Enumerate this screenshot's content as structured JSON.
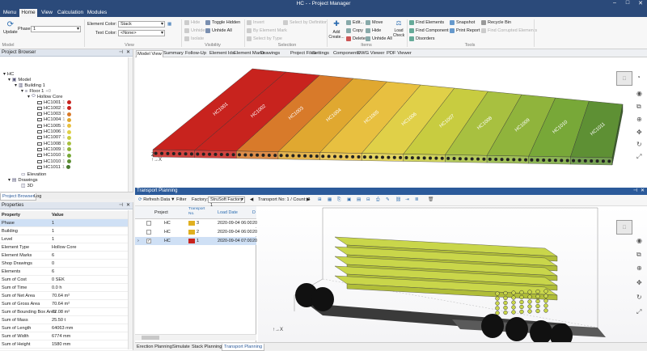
{
  "window": {
    "title": "HC - - Project Manager",
    "minimize": "–",
    "maximize": "□",
    "close": "✕"
  },
  "tabs": [
    "Menu",
    "Home",
    "View",
    "Calculation",
    "Modules"
  ],
  "ribbon": {
    "update": "Update",
    "phase_label": "Phase:",
    "phase_value": "1",
    "element_color_label": "Element Color:",
    "element_color_value": "Stack",
    "text_color_label": "Text Color:",
    "text_color_value": "<None>",
    "visibility": [
      "Hide",
      "Unhide",
      "Isolate",
      "Toggle Hidden",
      "Unhide All"
    ],
    "selection": [
      "Invert",
      "By Element Mark",
      "Select by Type",
      "Select by Definition"
    ],
    "create": "Add Create...",
    "items": [
      "Edit...",
      "Copy",
      "Delete",
      "Move",
      "Hide",
      "Unhide All",
      "Hide Ids"
    ],
    "load_check": "Load Check",
    "tools": [
      "Find Elements",
      "Find Component",
      "Disorders",
      "Snapshot",
      "Print Report",
      "Recycle Bin",
      "Find Corrupted Elements"
    ],
    "groups": [
      "Model",
      "View",
      "Visibility",
      "Selection",
      "Items",
      "Tools"
    ]
  },
  "project_browser": {
    "title": "Project Browser",
    "root": "HC",
    "model": "Model",
    "building": "Building 1",
    "floor": "Floor 1",
    "floor_badge": "+0",
    "group": "Hollow Core",
    "elements": [
      {
        "name": "HC1001",
        "count": "1",
        "color": "#c8231e"
      },
      {
        "name": "HC1002",
        "count": "1",
        "color": "#c8231e"
      },
      {
        "name": "HC1003",
        "count": "1",
        "color": "#d87a2a"
      },
      {
        "name": "HC1004",
        "count": "1",
        "color": "#e0a830"
      },
      {
        "name": "HC1005",
        "count": "1",
        "color": "#e8c040"
      },
      {
        "name": "HC1006",
        "count": "1",
        "color": "#e0d048"
      },
      {
        "name": "HC1007",
        "count": "1",
        "color": "#c8cc40"
      },
      {
        "name": "HC1008",
        "count": "1",
        "color": "#a8c040"
      },
      {
        "name": "HC1009",
        "count": "1",
        "color": "#90b43c"
      },
      {
        "name": "HC1010",
        "count": "1",
        "color": "#78a838"
      },
      {
        "name": "HC1010",
        "count": "1",
        "color": "#5e9034"
      },
      {
        "name": "HC1011",
        "count": "1",
        "color": "#4a7a30"
      }
    ],
    "elevation": "Elevation",
    "drawings": "Drawings",
    "threed": "3D",
    "tabs": [
      "Project Browser",
      "Log"
    ]
  },
  "properties": {
    "title": "Properties",
    "col_property": "Property",
    "col_value": "Value",
    "rows": [
      [
        "Phase",
        "1"
      ],
      [
        "Building",
        "1"
      ],
      [
        "Level",
        "1"
      ],
      [
        "Element Type",
        "Hollow Core"
      ],
      [
        "Element Marks",
        "6"
      ],
      [
        "Shop Drawings",
        "0"
      ],
      [
        "Elements",
        "6"
      ],
      [
        "Sum of Cost",
        "0 SEK"
      ],
      [
        "Sum of Time",
        "0.0 h"
      ],
      [
        "Sum of Net Area",
        "70.64 m²"
      ],
      [
        "Sum of Gross Area",
        "70.64 m²"
      ],
      [
        "Sum of Bounding Box Area",
        "72.08 m²"
      ],
      [
        "Sum of Mass",
        "25.50 t"
      ],
      [
        "Sum of Length",
        "64063 mm"
      ],
      [
        "Sum of Width",
        "6774 mm"
      ],
      [
        "Sum of Height",
        "1580 mm"
      ]
    ]
  },
  "view_tabs": [
    "Model View",
    "Summary",
    "Follow-Up",
    "Element Ids",
    "Element Marks",
    "Drawings",
    "Project Files",
    "Settings",
    "Components",
    "DWG Viewer",
    "PDF Viewer"
  ],
  "slab_labels": [
    "HC1001",
    "HC1002",
    "HC1003",
    "HC1004",
    "HC1005",
    "HC1006",
    "HC1007",
    "HC1008",
    "HC1009",
    "HC1010",
    "HC1011"
  ],
  "transport": {
    "title": "Transport Planning",
    "refresh": "Refresh Data",
    "filter": "Filter",
    "factory_label": "Factory:",
    "factory_value": "StruSoft Factory 1",
    "transport_label": "Transport No: 1 / Count: 3",
    "columns": [
      "Project",
      "Transport No.",
      "Load Date",
      "D"
    ],
    "rows": [
      {
        "project": "HC",
        "no": "3",
        "date": "2020-09-04 06:00",
        "d": "20",
        "color": "#e0b020",
        "checked": false
      },
      {
        "project": "HC",
        "no": "2",
        "date": "2020-09-04 06:00",
        "d": "20",
        "color": "#e0b020",
        "checked": false
      },
      {
        "project": "HC",
        "no": "1",
        "date": "2020-09-04 07:00",
        "d": "20",
        "color": "#c8231e",
        "checked": true
      }
    ],
    "bottom_tabs": [
      "Erection Planning",
      "Simulate",
      "Stack Planning",
      "Transport Planning"
    ]
  },
  "colors": {
    "accent": "#2b4a7a",
    "selected_row": "#cfe0f5"
  }
}
